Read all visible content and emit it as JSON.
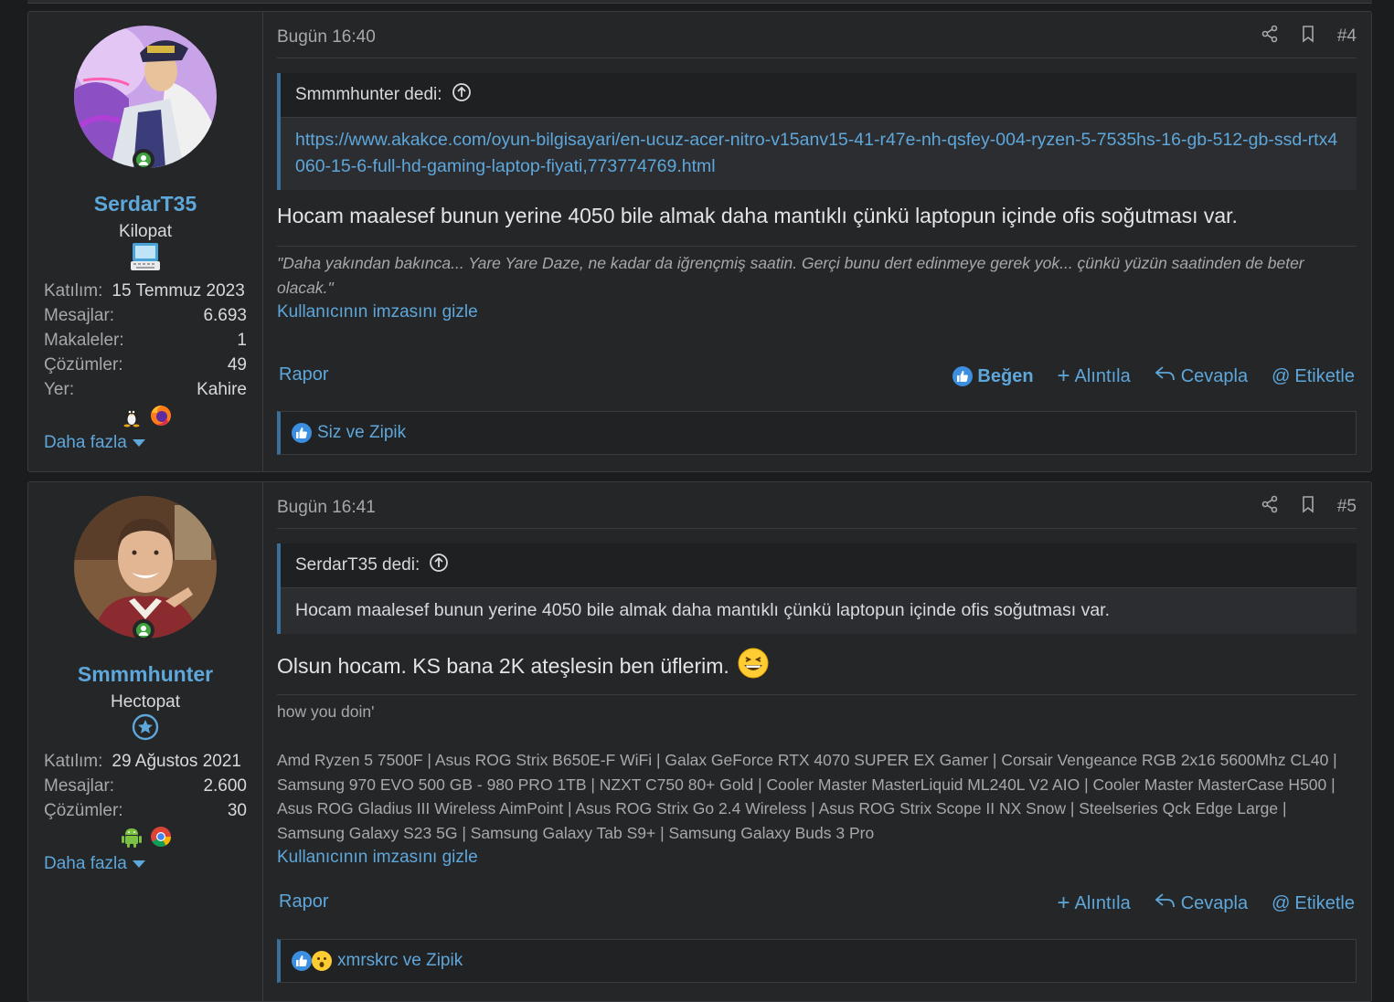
{
  "posts": [
    {
      "user": {
        "name": "SerdarT35",
        "title": "Kilopat",
        "stats": [
          {
            "k": "Katılım:",
            "v": "15 Temmuz 2023"
          },
          {
            "k": "Mesajlar:",
            "v": "6.693"
          },
          {
            "k": "Makaleler:",
            "v": "1"
          },
          {
            "k": "Çözümler:",
            "v": "49"
          },
          {
            "k": "Yer:",
            "v": "Kahire"
          }
        ],
        "more": "Daha fazla",
        "badge_icon": "laptop-icon",
        "platform_icons": [
          "linux-icon",
          "firefox-icon"
        ]
      },
      "time": "Bugün 16:40",
      "number": "#4",
      "quote": {
        "author": "Smmmhunter dedi:",
        "body": "https://www.akakce.com/oyun-bilgisayari/en-ucuz-acer-nitro-v15anv15-41-r47e-nh-qsfey-004-ryzen-5-7535hs-16-gb-512-gb-ssd-rtx4060-15-6-full-hd-gaming-laptop-fiyati,773774769.html"
      },
      "message": "Hocam maalesef bunun yerine 4050 bile almak daha mantıklı çünkü laptopun içinde ofis soğutması var.",
      "signature": "\"Daha yakından bakınca... Yare Yare Daze, ne kadar da iğrençmiş saatin. Gerçi bunu dert edinmeye gerek yok... çünkü yüzün saatinden de beter olacak.\"",
      "hide_sig": "Kullanıcının imzasını gizle",
      "actions": {
        "report": "Rapor",
        "like": "Beğen",
        "quote": "Alıntıla",
        "reply": "Cevapla",
        "tag": "Etiketle"
      },
      "reactions": "Siz ve Zipik"
    },
    {
      "user": {
        "name": "Smmmhunter",
        "title": "Hectopat",
        "stats": [
          {
            "k": "Katılım:",
            "v": "29 Ağustos 2021"
          },
          {
            "k": "Mesajlar:",
            "v": "2.600"
          },
          {
            "k": "Çözümler:",
            "v": "30"
          }
        ],
        "more": "Daha fazla",
        "badge_icon": "star-icon",
        "platform_icons": [
          "android-icon",
          "chrome-icon"
        ]
      },
      "time": "Bugün 16:41",
      "number": "#5",
      "quote": {
        "author": "SerdarT35 dedi:",
        "body": "Hocam maalesef bunun yerine 4050 bile almak daha mantıklı çünkü laptopun içinde ofis soğutması var."
      },
      "message": "Olsun hocam. KS bana 2K ateşlesin ben üflerim.",
      "signature_line1": "how you doin'",
      "signature": "Amd Ryzen 5 7500F | Asus ROG Strix B650E-F WiFi | Galax GeForce RTX 4070 SUPER EX Gamer | Corsair Vengeance RGB 2x16 5600Mhz CL40 | Samsung 970 EVO 500 GB - 980 PRO 1TB | NZXT C750 80+ Gold | Cooler Master MasterLiquid ML240L V2 AIO | Cooler Master MasterCase H500 | Asus ROG Gladius III Wireless AimPoint | Asus ROG Strix Go 2.4 Wireless | Asus ROG Strix Scope II NX Snow | Steelseries Qck Edge Large | Samsung Galaxy S23 5G | Samsung Galaxy Tab S9+ | Samsung Galaxy Buds 3 Pro",
      "hide_sig": "Kullanıcının imzasını gizle",
      "actions": {
        "report": "Rapor",
        "quote": "Alıntıla",
        "reply": "Cevapla",
        "tag": "Etiketle"
      },
      "reactions": "xmrskrc ve Zipik"
    }
  ],
  "colors": {
    "accent": "#5ea7db",
    "background": "#1b1c1e",
    "panel": "#252628",
    "online": "#3fa33f"
  }
}
